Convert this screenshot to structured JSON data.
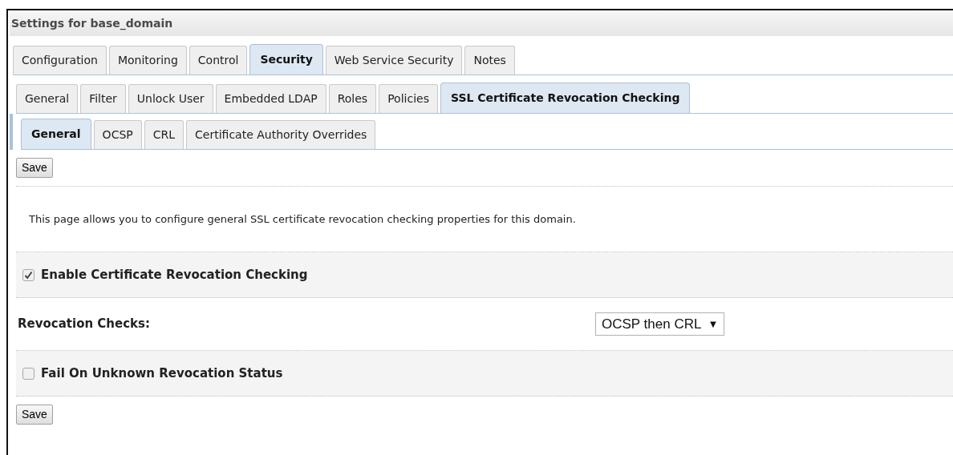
{
  "title": "Settings for base_domain",
  "tabs": [
    {
      "label": "Configuration",
      "selected": false
    },
    {
      "label": "Monitoring",
      "selected": false
    },
    {
      "label": "Control",
      "selected": false
    },
    {
      "label": "Security",
      "selected": true
    },
    {
      "label": "Web Service Security",
      "selected": false
    },
    {
      "label": "Notes",
      "selected": false
    }
  ],
  "subtabs": [
    {
      "label": "General",
      "selected": false
    },
    {
      "label": "Filter",
      "selected": false
    },
    {
      "label": "Unlock User",
      "selected": false
    },
    {
      "label": "Embedded LDAP",
      "selected": false
    },
    {
      "label": "Roles",
      "selected": false
    },
    {
      "label": "Policies",
      "selected": false
    },
    {
      "label": "SSL Certificate Revocation Checking",
      "selected": true
    }
  ],
  "subsubtabs": [
    {
      "label": "General",
      "selected": true
    },
    {
      "label": "OCSP",
      "selected": false
    },
    {
      "label": "CRL",
      "selected": false
    },
    {
      "label": "Certificate Authority Overrides",
      "selected": false
    }
  ],
  "save_top": "Save",
  "description": "This page allows you to configure general SSL certificate revocation checking properties for this domain.",
  "fields": [
    {
      "kind": "checkbox",
      "label": "Enable Certificate Revocation Checking",
      "checked": true
    },
    {
      "kind": "select",
      "label": "Revocation Checks:",
      "value": "OCSP then CRL",
      "caret": "▼"
    },
    {
      "kind": "checkbox",
      "label": "Fail On Unknown Revocation Status",
      "checked": false
    }
  ],
  "save_bottom": "Save"
}
